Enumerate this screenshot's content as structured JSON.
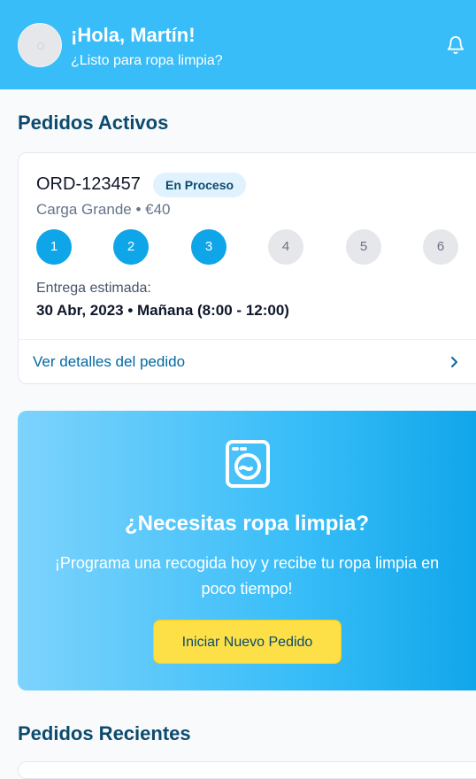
{
  "header": {
    "greeting": "¡Hola, Martín!",
    "subtitle": "¿Listo para ropa limpia?",
    "avatar_icon": "user-avatar",
    "notification_icon": "bell-icon"
  },
  "active_orders": {
    "title": "Pedidos Activos",
    "order": {
      "id": "ORD-123457",
      "status": "En Proceso",
      "summary": "Carga Grande • €40",
      "steps": [
        {
          "number": "1",
          "state": "completed"
        },
        {
          "number": "2",
          "state": "completed"
        },
        {
          "number": "3",
          "state": "completed"
        },
        {
          "number": "4",
          "state": "pending"
        },
        {
          "number": "5",
          "state": "pending"
        },
        {
          "number": "6",
          "state": "pending"
        }
      ],
      "eta_label": "Entrega estimada:",
      "eta_value": "30 Abr, 2023 • Mañana (8:00 - 12:00)",
      "details_link": "Ver detalles del pedido"
    }
  },
  "promo": {
    "icon": "washing-machine-icon",
    "title": "¿Necesitas ropa limpia?",
    "text": "¡Programa una recogida hoy y recibe tu ropa limpia en poco tiempo!",
    "button": "Iniciar Nuevo Pedido"
  },
  "recent_orders": {
    "title": "Pedidos Recientes"
  },
  "colors": {
    "header_bg": "#38bdf8",
    "accent": "#0ea5e9",
    "title": "#0c4a6e",
    "button": "#fde047"
  }
}
